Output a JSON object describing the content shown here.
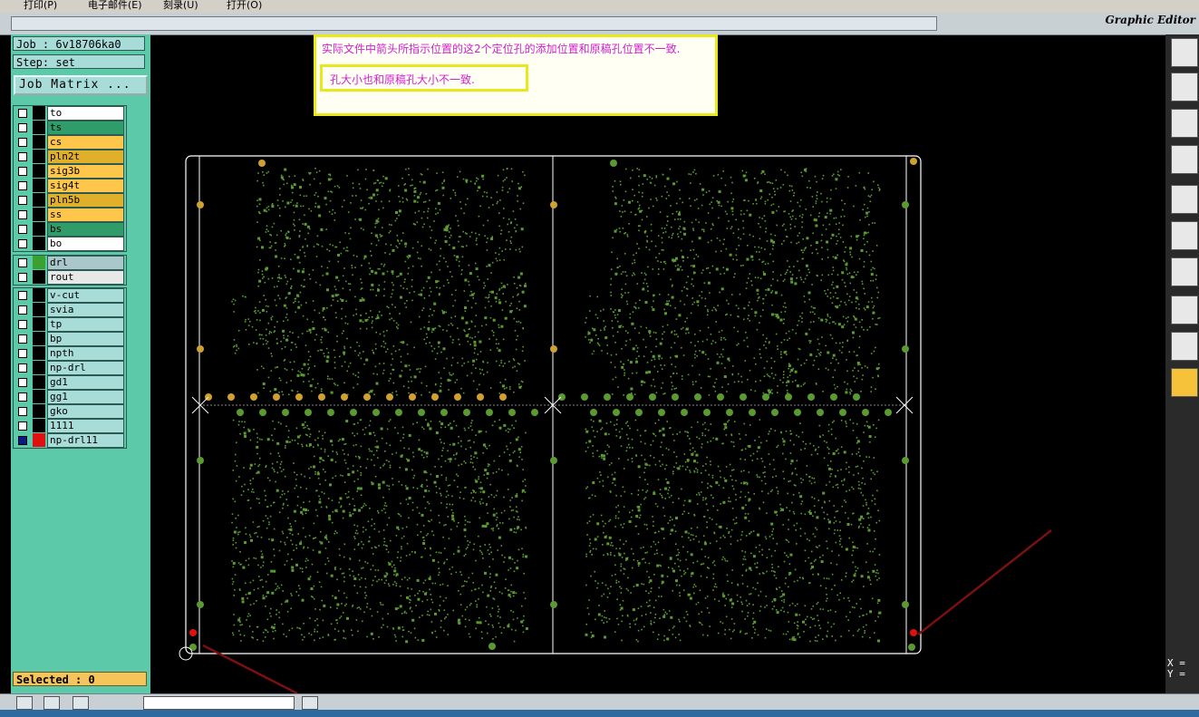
{
  "menu": [
    {
      "label": "打印(P)"
    },
    {
      "label": "电子邮件(E)"
    },
    {
      "label": "刻录(U)"
    },
    {
      "label": "打开(O)"
    }
  ],
  "header": {
    "app_title": "Graphic Editor"
  },
  "job": {
    "job_label": "Job : 6v18706ka0",
    "step_label": "Step: set",
    "matrix_button": "Job Matrix ..."
  },
  "layers_board": [
    {
      "name": "to",
      "color": "#ffffff"
    },
    {
      "name": "ts",
      "color": "#2f9c6a"
    },
    {
      "name": "cs",
      "color": "#ffc64c"
    },
    {
      "name": "pln2t",
      "color": "#e1b02a"
    },
    {
      "name": "sig3b",
      "color": "#ffc64c"
    },
    {
      "name": "sig4t",
      "color": "#ffc64c"
    },
    {
      "name": "pln5b",
      "color": "#e1b02a"
    },
    {
      "name": "ss",
      "color": "#ffc64c"
    },
    {
      "name": "bs",
      "color": "#2f9c6a"
    },
    {
      "name": "bo",
      "color": "#ffffff"
    }
  ],
  "layers_drill": [
    {
      "name": "drl",
      "color": "#aac8cc",
      "swatch": "#3aa030"
    },
    {
      "name": "rout",
      "color": "#e8e8e8",
      "swatch": ""
    }
  ],
  "layers_misc": [
    {
      "name": "v-cut"
    },
    {
      "name": "svia"
    },
    {
      "name": "tp"
    },
    {
      "name": "bp"
    },
    {
      "name": "npth"
    },
    {
      "name": "np-drl"
    },
    {
      "name": "gd1"
    },
    {
      "name": "gg1"
    },
    {
      "name": "gko"
    },
    {
      "name": "1111"
    },
    {
      "name": "np-drl11",
      "swatch": "#e01010"
    }
  ],
  "status": {
    "selected": "Selected : 0",
    "x_label": "X =",
    "y_label": "Y ="
  },
  "annotation": {
    "line1": "实际文件中箭头所指示位置的这2个定位孔的添加位置和原稿孔位置不一致.",
    "line2": "孔大小也和原稿孔大小不一致."
  },
  "colors": {
    "copper": "#5a9a30",
    "pad_orange": "#d0a030",
    "marker_red": "#e01010",
    "arrow": "#7a1010",
    "outline": "#ffffff"
  },
  "toolbar_icons": [
    "clipboard-icon",
    "copy-layer-icon",
    "fit-screen-icon",
    "measure-icon",
    "snap-icon",
    "net-icon",
    "line-icon",
    "select-feature-icon",
    "polygon-icon",
    "pointer-icon"
  ]
}
